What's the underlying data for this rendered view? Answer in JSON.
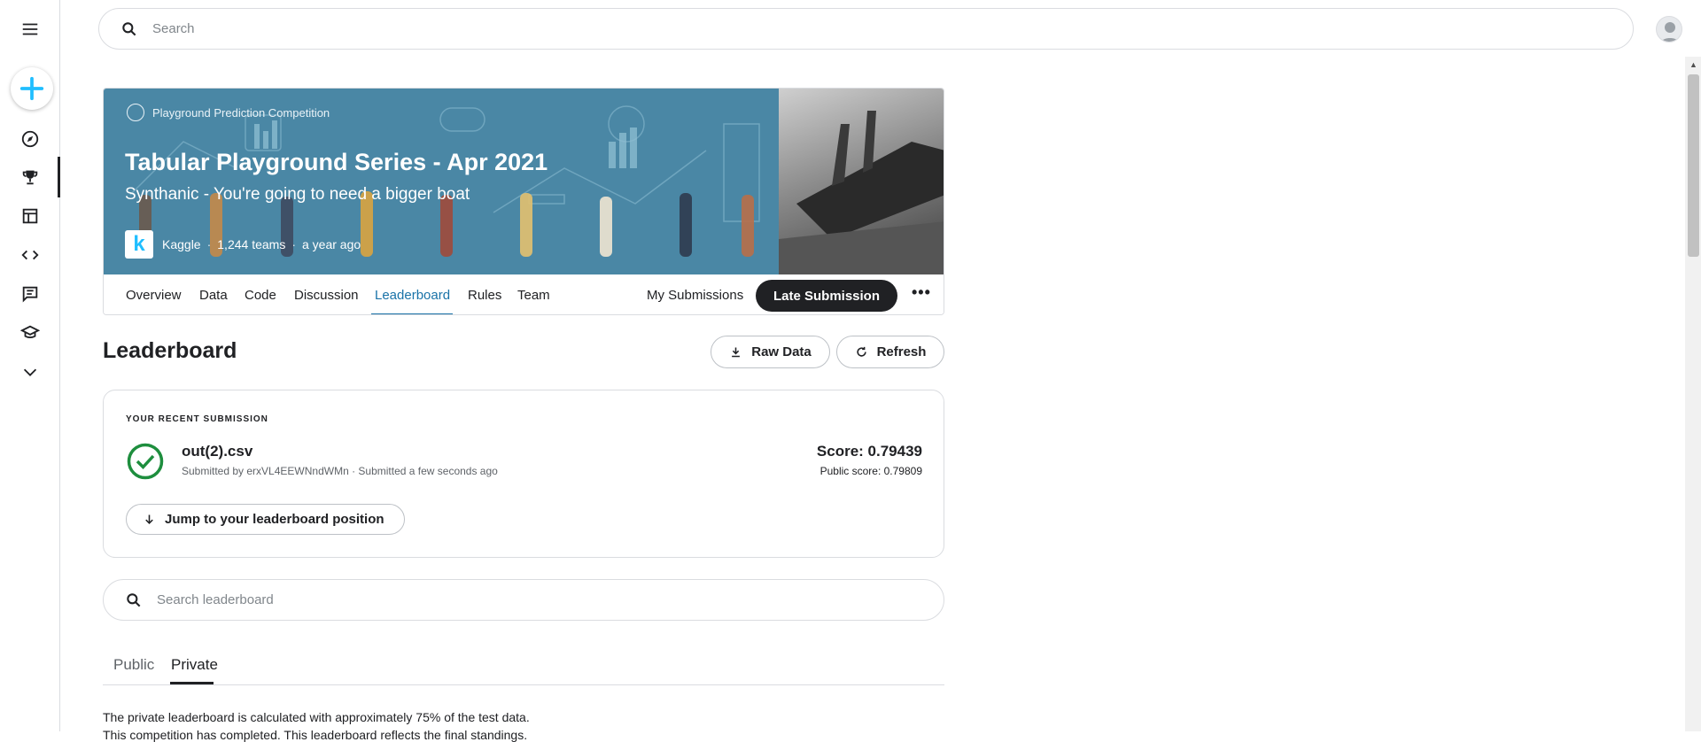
{
  "search": {
    "placeholder": "Search"
  },
  "competition": {
    "type_label": "Playground Prediction Competition",
    "title": "Tabular Playground Series - Apr 2021",
    "subtitle": "Synthanic - You're going to need a bigger boat",
    "org_logo_letter": "k",
    "org": "Kaggle",
    "teams": "1,244 teams",
    "time": "a year ago"
  },
  "tabs": [
    {
      "label": "Overview"
    },
    {
      "label": "Data"
    },
    {
      "label": "Code"
    },
    {
      "label": "Discussion"
    },
    {
      "label": "Leaderboard"
    },
    {
      "label": "Rules"
    },
    {
      "label": "Team"
    }
  ],
  "actions": {
    "my_submissions": "My Submissions",
    "late_submission": "Late Submission",
    "more": "•••"
  },
  "leaderboard": {
    "title": "Leaderboard",
    "raw_data": "Raw Data",
    "refresh": "Refresh",
    "search_placeholder": "Search leaderboard"
  },
  "recent": {
    "label": "YOUR RECENT SUBMISSION",
    "filename": "out(2).csv",
    "meta": "Submitted by erxVL4EEWNndWMn · Submitted a few seconds ago",
    "score": "Score: 0.79439",
    "public_score": "Public score: 0.79809",
    "jump": "Jump to your leaderboard position"
  },
  "board_tabs": {
    "public": "Public",
    "private": "Private"
  },
  "notes": {
    "line1": "The private leaderboard is calculated with approximately 75% of the test data.",
    "line2": "This competition has completed. This leaderboard reflects the final standings."
  },
  "colors": {
    "accent": "#1a73a8",
    "banner": "#4a87a5",
    "create_plus": "#20beff",
    "success": "#1e8e3e"
  }
}
